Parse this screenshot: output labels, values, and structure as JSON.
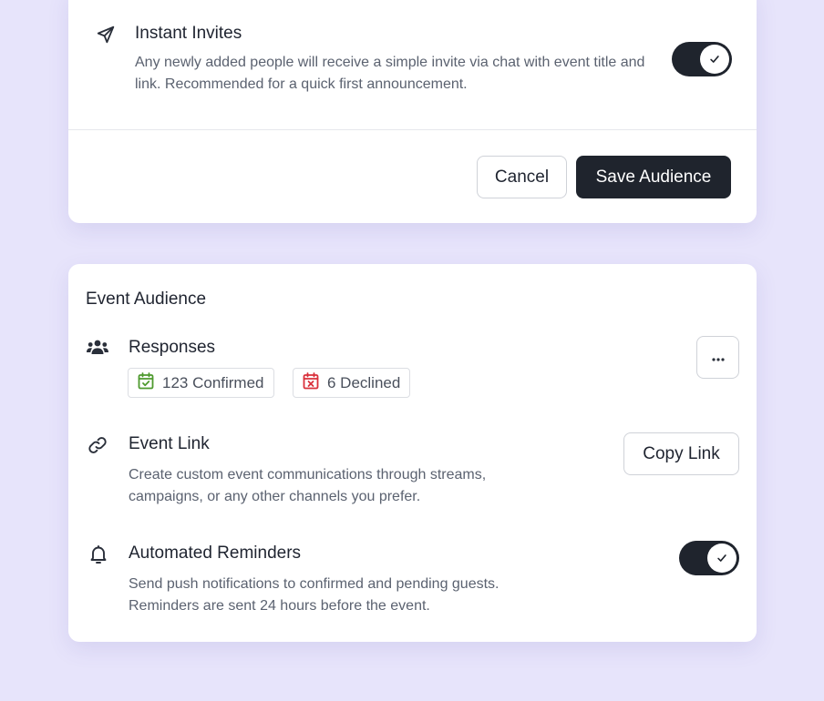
{
  "instant_invites": {
    "title": "Instant Invites",
    "description": "Any newly added people will receive a simple invite via chat with event title and link. Recommended for a quick first announcement.",
    "enabled": true,
    "icon": "send-icon"
  },
  "footer": {
    "cancel_label": "Cancel",
    "save_label": "Save Audience"
  },
  "event_audience": {
    "section_title": "Event Audience",
    "responses": {
      "title": "Responses",
      "icon": "users-icon",
      "confirmed_label": "123 Confirmed",
      "declined_label": "6 Declined",
      "more_icon": "ellipsis-icon"
    },
    "event_link": {
      "title": "Event Link",
      "icon": "link-icon",
      "description": "Create custom event communications through streams, campaigns, or any other channels you prefer.",
      "button_label": "Copy Link"
    },
    "reminders": {
      "title": "Automated Reminders",
      "icon": "bell-icon",
      "description": "Send push notifications to confirmed and pending guests. Reminders are sent 24 hours before the event.",
      "enabled": true
    }
  },
  "colors": {
    "background": "#e7e4fb",
    "card": "#ffffff",
    "primary_dark": "#1f242d",
    "confirmed_green": "#4e9a2e",
    "declined_red": "#d9303b"
  }
}
